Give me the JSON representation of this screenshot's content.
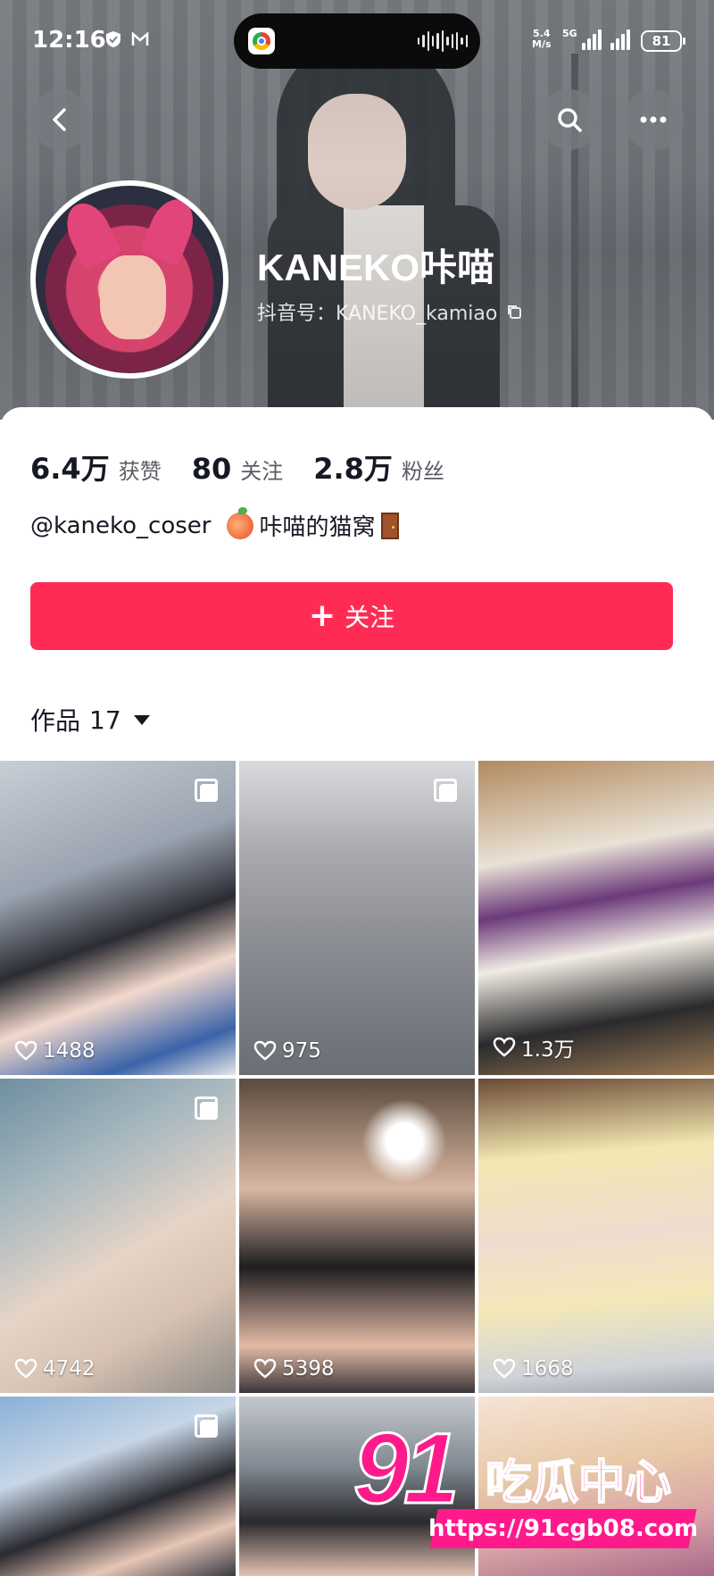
{
  "status_bar": {
    "time": "12:16",
    "net_speed_value": "5.4",
    "net_speed_unit": "M/s",
    "network": "5G",
    "battery": "81"
  },
  "profile": {
    "name": "KANEKO咔喵",
    "douyin_id": "抖音号：KANEKO_kamiao",
    "bio_handle": "@kaneko_coser",
    "bio_text": "咔喵的猫窝"
  },
  "stats": [
    {
      "value": "6.4万",
      "label": "获赞"
    },
    {
      "value": "80",
      "label": "关注"
    },
    {
      "value": "2.8万",
      "label": "粉丝"
    }
  ],
  "follow_button": {
    "icon": "+",
    "label": "关注"
  },
  "works_tab": {
    "label": "作品",
    "count": "17"
  },
  "grid": [
    {
      "likes": "1488",
      "multi": true
    },
    {
      "likes": "975",
      "multi": true
    },
    {
      "likes": "1.3万",
      "multi": false
    },
    {
      "likes": "4742",
      "multi": true
    },
    {
      "likes": "5398",
      "multi": false
    },
    {
      "likes": "1668",
      "multi": false
    },
    {
      "likes": "",
      "multi": true
    },
    {
      "likes": "",
      "multi": false
    },
    {
      "likes": "",
      "multi": false
    }
  ],
  "watermark": {
    "number": "91",
    "text": "吃瓜中心",
    "url": "https://91cgb08.com"
  },
  "colors": {
    "accent": "#fe2c55",
    "watermark": "#ff1a8c"
  },
  "icons": [
    "back-icon",
    "search-icon",
    "more-icon",
    "copy-icon",
    "heart-icon",
    "multi-image-icon",
    "caret-down-icon"
  ]
}
